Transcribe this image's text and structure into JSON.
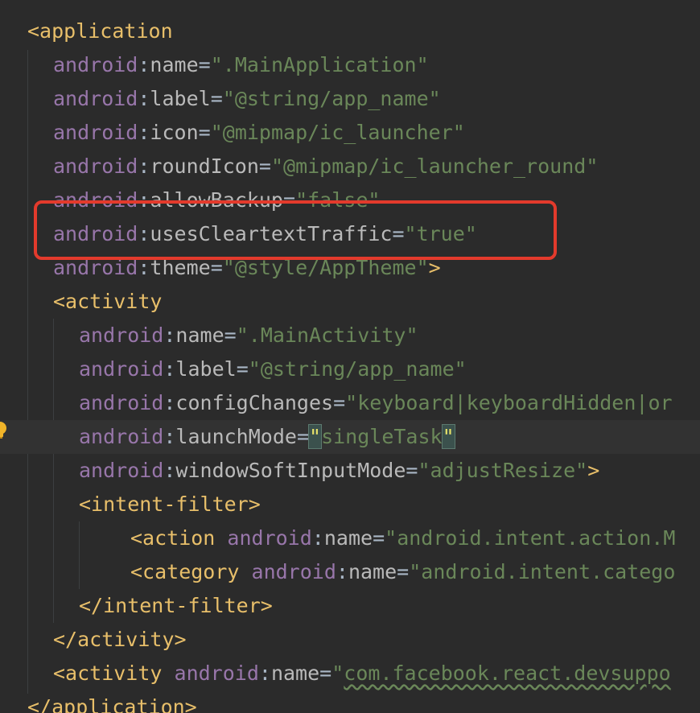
{
  "colors": {
    "background": "#2b2b2b",
    "tag": "#e8bf6a",
    "namespace": "#9876aa",
    "attribute": "#bababa",
    "string": "#6a8759",
    "highlight_box": "#e33a2c"
  },
  "icons": {
    "intention_bulb": "lightbulb-icon"
  },
  "code": {
    "application_open": "<application",
    "ns": "android",
    "colon": ":",
    "eq": "=",
    "quote": "\"",
    "tag_close": ">",
    "app_attrs": [
      {
        "name": "name",
        "value": ".MainApplication"
      },
      {
        "name": "label",
        "value": "@string/app_name"
      },
      {
        "name": "icon",
        "value": "@mipmap/ic_launcher"
      },
      {
        "name": "roundIcon",
        "value": "@mipmap/ic_launcher_round"
      },
      {
        "name": "allowBackup",
        "value": "false"
      },
      {
        "name": "usesCleartextTraffic",
        "value": "true"
      },
      {
        "name": "theme",
        "value": "@style/AppTheme"
      }
    ],
    "activity_open": "<activity",
    "activity_attrs": [
      {
        "name": "name",
        "value": ".MainActivity"
      },
      {
        "name": "label",
        "value": "@string/app_name"
      },
      {
        "name": "configChanges",
        "value": "keyboard|keyboardHidden|or"
      },
      {
        "name": "launchMode",
        "value": "singleTask"
      },
      {
        "name": "windowSoftInputMode",
        "value": "adjustResize"
      }
    ],
    "intent_filter_open": "<intent-filter>",
    "action_open": "<action",
    "action_value": "android.intent.action.M",
    "category_open": "<category",
    "category_value": "android.intent.catego",
    "intent_filter_close": "</intent-filter>",
    "activity_close": "</activity>",
    "dev_activity_value": "com.facebook.react.devsuppo",
    "application_close": "</application>"
  }
}
